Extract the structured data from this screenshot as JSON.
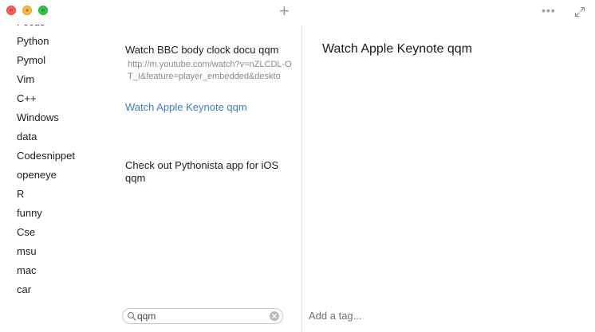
{
  "titlebar": {
    "icons": [
      "close-button",
      "minimize-button",
      "zoom-button",
      "plus-icon",
      "more-icon",
      "expand-icon"
    ],
    "plus_label": "+",
    "more_label": "•••"
  },
  "sidebar": {
    "tags": [
      "Focus",
      "Python",
      "Pymol",
      "Vim",
      "C++",
      "Windows",
      "data",
      "Codesnippet",
      "openeye",
      "R",
      "funny",
      "Cse",
      "msu",
      "mac",
      "car"
    ],
    "back_icon": "chevron-left-icon"
  },
  "notelist": {
    "notes": [
      {
        "title": "Watch BBC body clock docu qqm",
        "body": "http://m.youtube.com/watch?v=nZLCDL-OT_I&feature=player_embedded&deskto"
      },
      {
        "title": "Watch Apple Keynote qqm",
        "body": ""
      },
      {
        "title": "Check out Pythonista app for iOS qqm",
        "body": ""
      }
    ],
    "search": {
      "value": "qqm",
      "placeholder": "Search"
    }
  },
  "editor": {
    "title": "Watch Apple Keynote qqm",
    "tag_placeholder": "Add a tag..."
  },
  "colors": {
    "accent": "#3d7dbf",
    "divider": "#e3e3e3"
  }
}
